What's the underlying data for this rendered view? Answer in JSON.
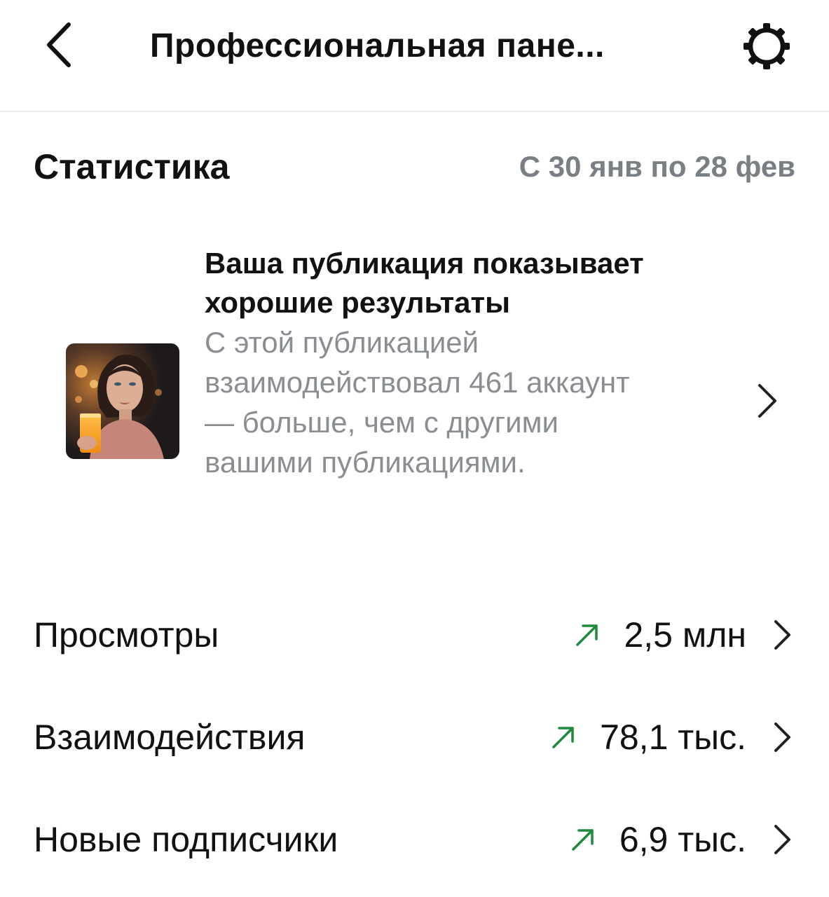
{
  "header": {
    "title": "Профессиональная пане...",
    "back_icon": "chevron-left-icon",
    "settings_icon": "gear-icon"
  },
  "statistics": {
    "title": "Статистика",
    "date_range": "С 30 янв по 28 фев"
  },
  "insight": {
    "title": "Ваша публикация показывает хорошие результаты",
    "body": "С этой публикацией взаимодействовал 461 аккаунт — больше, чем с другими вашими публикациями.",
    "thumbnail": "post-thumbnail"
  },
  "metrics": [
    {
      "label": "Просмотры",
      "value": "2,5 млн",
      "trend": "up"
    },
    {
      "label": "Взаимодействия",
      "value": "78,1 тыс.",
      "trend": "up"
    },
    {
      "label": "Новые подписчики",
      "value": "6,9 тыс.",
      "trend": "up"
    }
  ],
  "colors": {
    "trend_up": "#1e8a3c",
    "muted_text": "#7a7f85",
    "divider": "#ececec"
  }
}
